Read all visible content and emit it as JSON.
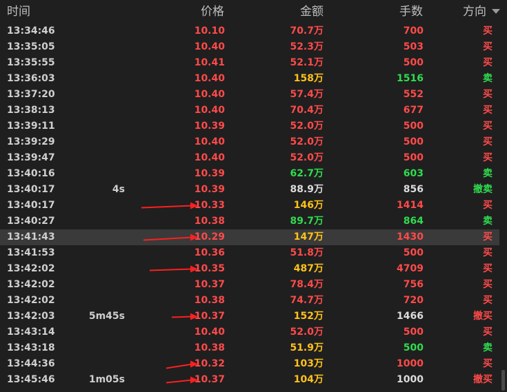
{
  "header": {
    "time": "时间",
    "price": "价格",
    "amount": "金额",
    "volume": "手数",
    "direction": "方向"
  },
  "colors": {
    "up": "#ff4a4a",
    "down": "#2fdc4e",
    "big": "#ffc21a",
    "neutral": "#dcdcdc"
  },
  "rows": [
    {
      "time": "13:34:46",
      "gap": "",
      "price": "10.10",
      "price_color": "red",
      "amount": "70.7万",
      "amount_color": "red",
      "volume": "700",
      "volume_color": "red",
      "dir": "买",
      "dir_color": "red"
    },
    {
      "time": "13:35:05",
      "gap": "",
      "price": "10.40",
      "price_color": "red",
      "amount": "52.3万",
      "amount_color": "red",
      "volume": "503",
      "volume_color": "red",
      "dir": "买",
      "dir_color": "red"
    },
    {
      "time": "13:35:55",
      "gap": "",
      "price": "10.41",
      "price_color": "red",
      "amount": "52.1万",
      "amount_color": "red",
      "volume": "500",
      "volume_color": "red",
      "dir": "买",
      "dir_color": "red"
    },
    {
      "time": "13:36:03",
      "gap": "",
      "price": "10.40",
      "price_color": "red",
      "amount": "158万",
      "amount_color": "yellow",
      "volume": "1516",
      "volume_color": "green",
      "dir": "卖",
      "dir_color": "green"
    },
    {
      "time": "13:37:20",
      "gap": "",
      "price": "10.40",
      "price_color": "red",
      "amount": "57.4万",
      "amount_color": "red",
      "volume": "552",
      "volume_color": "red",
      "dir": "买",
      "dir_color": "red"
    },
    {
      "time": "13:38:13",
      "gap": "",
      "price": "10.40",
      "price_color": "red",
      "amount": "70.4万",
      "amount_color": "red",
      "volume": "677",
      "volume_color": "red",
      "dir": "买",
      "dir_color": "red"
    },
    {
      "time": "13:39:11",
      "gap": "",
      "price": "10.39",
      "price_color": "red",
      "amount": "52.0万",
      "amount_color": "red",
      "volume": "500",
      "volume_color": "red",
      "dir": "买",
      "dir_color": "red"
    },
    {
      "time": "13:39:29",
      "gap": "",
      "price": "10.40",
      "price_color": "red",
      "amount": "52.0万",
      "amount_color": "red",
      "volume": "500",
      "volume_color": "red",
      "dir": "买",
      "dir_color": "red"
    },
    {
      "time": "13:39:47",
      "gap": "",
      "price": "10.40",
      "price_color": "red",
      "amount": "52.0万",
      "amount_color": "red",
      "volume": "500",
      "volume_color": "red",
      "dir": "买",
      "dir_color": "red"
    },
    {
      "time": "13:40:16",
      "gap": "",
      "price": "10.39",
      "price_color": "red",
      "amount": "62.7万",
      "amount_color": "green",
      "volume": "603",
      "volume_color": "green",
      "dir": "卖",
      "dir_color": "green"
    },
    {
      "time": "13:40:17",
      "gap": "4s",
      "price": "10.39",
      "price_color": "red",
      "amount": "88.9万",
      "amount_color": "white",
      "volume": "856",
      "volume_color": "white",
      "dir": "撤卖",
      "dir_color": "green"
    },
    {
      "time": "13:40:17",
      "gap": "",
      "price": "10.33",
      "price_color": "red",
      "amount": "146万",
      "amount_color": "yellow",
      "volume": "1414",
      "volume_color": "red",
      "dir": "买",
      "dir_color": "red"
    },
    {
      "time": "13:40:27",
      "gap": "",
      "price": "10.38",
      "price_color": "red",
      "amount": "89.7万",
      "amount_color": "green",
      "volume": "864",
      "volume_color": "green",
      "dir": "卖",
      "dir_color": "green"
    },
    {
      "time": "13:41:43",
      "gap": "",
      "price": "10.29",
      "price_color": "red",
      "amount": "147万",
      "amount_color": "yellow",
      "volume": "1430",
      "volume_color": "red",
      "dir": "买",
      "dir_color": "red",
      "selected": true
    },
    {
      "time": "13:41:53",
      "gap": "",
      "price": "10.36",
      "price_color": "red",
      "amount": "51.8万",
      "amount_color": "red",
      "volume": "500",
      "volume_color": "red",
      "dir": "买",
      "dir_color": "red"
    },
    {
      "time": "13:42:02",
      "gap": "",
      "price": "10.35",
      "price_color": "red",
      "amount": "487万",
      "amount_color": "yellow",
      "volume": "4709",
      "volume_color": "red",
      "dir": "买",
      "dir_color": "red"
    },
    {
      "time": "13:42:02",
      "gap": "",
      "price": "10.37",
      "price_color": "red",
      "amount": "78.4万",
      "amount_color": "red",
      "volume": "756",
      "volume_color": "red",
      "dir": "买",
      "dir_color": "red"
    },
    {
      "time": "13:42:02",
      "gap": "",
      "price": "10.38",
      "price_color": "red",
      "amount": "74.7万",
      "amount_color": "red",
      "volume": "720",
      "volume_color": "red",
      "dir": "买",
      "dir_color": "red"
    },
    {
      "time": "13:42:03",
      "gap": "5m45s",
      "price": "10.37",
      "price_color": "red",
      "amount": "152万",
      "amount_color": "yellow",
      "volume": "1466",
      "volume_color": "white",
      "dir": "撤买",
      "dir_color": "red"
    },
    {
      "time": "13:43:14",
      "gap": "",
      "price": "10.40",
      "price_color": "red",
      "amount": "52.0万",
      "amount_color": "red",
      "volume": "500",
      "volume_color": "red",
      "dir": "买",
      "dir_color": "red"
    },
    {
      "time": "13:43:18",
      "gap": "",
      "price": "10.38",
      "price_color": "red",
      "amount": "51.9万",
      "amount_color": "yellow",
      "volume": "500",
      "volume_color": "green",
      "dir": "卖",
      "dir_color": "green"
    },
    {
      "time": "13:44:36",
      "gap": "",
      "price": "10.32",
      "price_color": "red",
      "amount": "103万",
      "amount_color": "yellow",
      "volume": "1000",
      "volume_color": "red",
      "dir": "买",
      "dir_color": "red"
    },
    {
      "time": "13:45:46",
      "gap": "1m05s",
      "price": "10.37",
      "price_color": "red",
      "amount": "104万",
      "amount_color": "yellow",
      "volume": "1000",
      "volume_color": "white",
      "dir": "撤买",
      "dir_color": "red"
    }
  ],
  "annotations": {
    "arrow_color": "#ff1f1f",
    "arrow_row_indices": [
      11,
      13,
      15,
      18,
      21,
      22
    ]
  }
}
